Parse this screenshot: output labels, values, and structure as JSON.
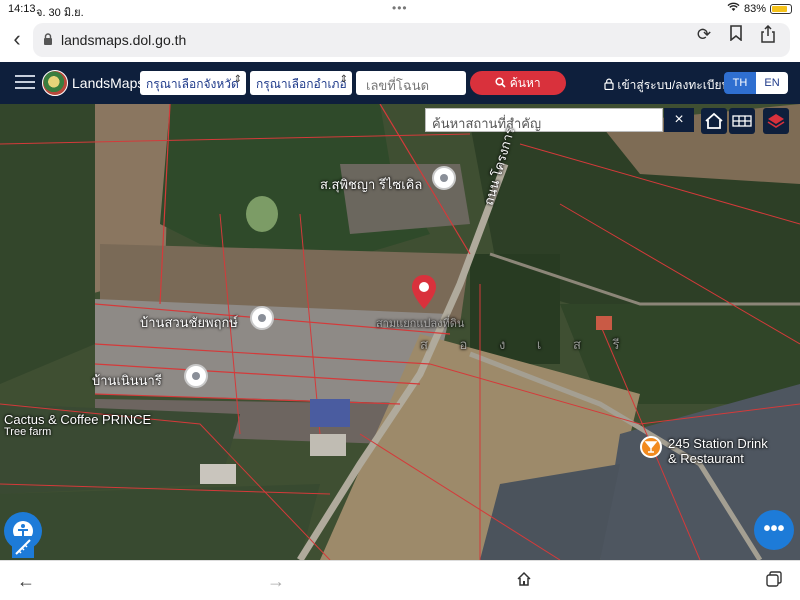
{
  "status": {
    "time": "14:13",
    "date": "จ. 30 มิ.ย.",
    "battery": "83%"
  },
  "browser": {
    "url": "landsmaps.dol.go.th"
  },
  "nav": {
    "brand": "LandsMaps",
    "province_select": "กรุณาเลือกจังหวัด",
    "district_select": "กรุณาเลือกอำเภอ",
    "deed_placeholder": "เลขที่โฉนด",
    "search_button": "ค้นหา",
    "login": "เข้าสู่ระบบ/ลงทะเบียน",
    "lang_th": "TH",
    "lang_en": "EN"
  },
  "map": {
    "place_search_placeholder": "ค้นหาสถานที่สำคัญ",
    "labels": {
      "recycle": "ส.สุพิชญา รีไซเคิล",
      "road": "ถนน โครงการ",
      "home1": "บ้านสวนชัยพฤกษ์",
      "home2": "บ้านเนินนารี",
      "faded": "สามแยกแปลงที่ดิน",
      "cactus": "Cactus & Coffee PRINCE",
      "tree_farm": "Tree farm",
      "station": "245 Station Drink",
      "station2": "& Restaurant",
      "hidden_letters": "ส อ ง เ ส รี"
    },
    "accent": "#d9313c",
    "nav_color": "#0e1f3c",
    "fab_color": "#1d7bd8"
  }
}
